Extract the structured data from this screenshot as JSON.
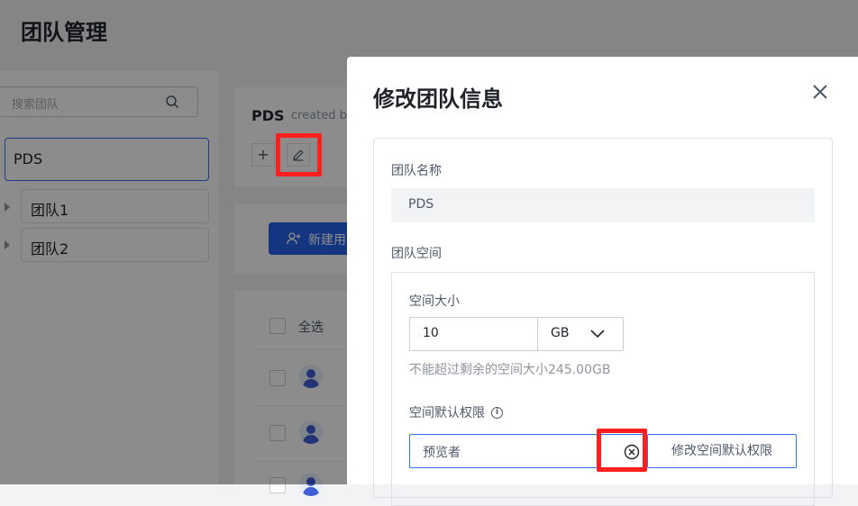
{
  "page": {
    "title": "团队管理"
  },
  "sidebar": {
    "search_placeholder": "搜索团队",
    "tree": {
      "root": "PDS",
      "children": [
        "团队1",
        "团队2"
      ]
    }
  },
  "team_header": {
    "name": "PDS",
    "created_text": "created b"
  },
  "users": {
    "new_user_label": "新建用",
    "select_all": "全选"
  },
  "modal": {
    "title": "修改团队信息",
    "team_name_label": "团队名称",
    "team_name_value": "PDS",
    "team_space_label": "团队空间",
    "space_size_label": "空间大小",
    "space_size_value": "10",
    "space_unit": "GB",
    "space_hint": "不能超过剩余的空间大小245.00GB",
    "default_perm_label": "空间默认权限",
    "default_perm_value": "预览者",
    "modify_perm_button": "修改空间默认权限"
  },
  "colors": {
    "accent": "#3370ff",
    "primary_button": "#2563eb",
    "highlight": "#ff1f1f"
  }
}
